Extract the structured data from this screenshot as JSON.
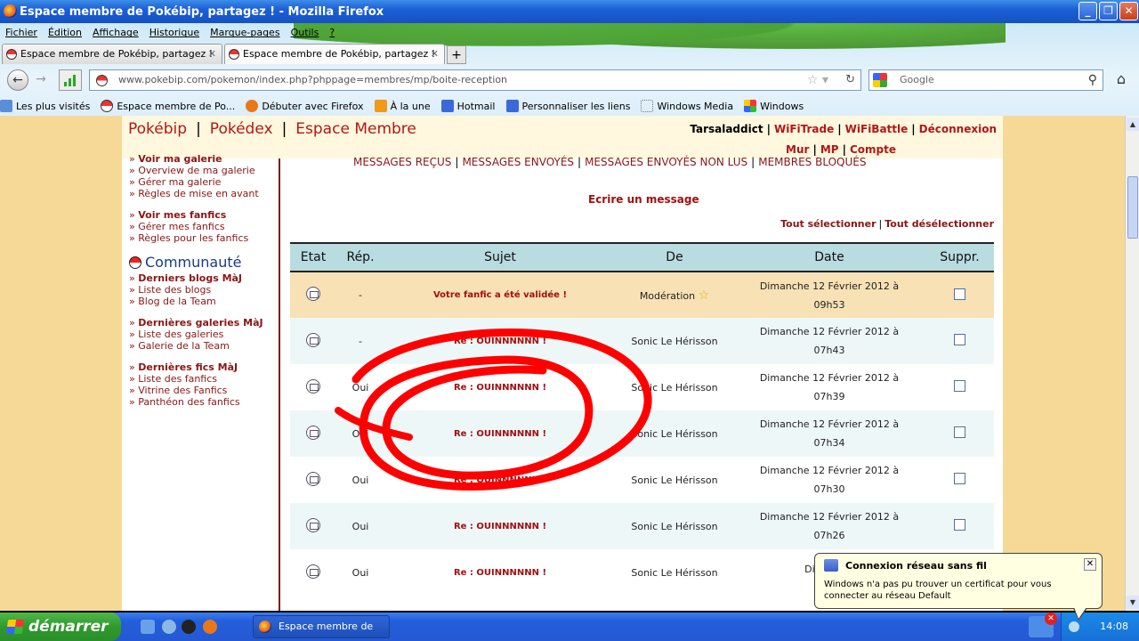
{
  "window": {
    "title": "Espace membre de Pokébip, partagez ! - Mozilla Firefox"
  },
  "menu": [
    "Fichier",
    "Édition",
    "Affichage",
    "Historique",
    "Marque-pages",
    "Outils",
    "?"
  ],
  "tabs": [
    {
      "label": "Espace membre de Pokébip, partagez !"
    },
    {
      "label": "Espace membre de Pokébip, partagez !"
    }
  ],
  "url": "www.pokebip.com/pokemon/index.php?phppage=membres/mp/boite-reception",
  "search_placeholder": "Google",
  "bookmarks": [
    "Les plus visités",
    "Espace membre de Po...",
    "Débuter avec Firefox",
    "À la une",
    "Hotmail",
    "Personnaliser les liens",
    "Windows Media",
    "Windows"
  ],
  "site": {
    "nav": [
      "Pokébip",
      "Pokédex",
      "Espace Membre"
    ],
    "user": "Tarsaladdict",
    "user_links": [
      "WiFiTrade",
      "WiFiBattle",
      "Déconnexion"
    ],
    "user_links2": [
      "Mur",
      "MP",
      "Compte"
    ]
  },
  "sidebar": {
    "group1": [
      "Voir ma galerie",
      "Overview de ma galerie",
      "Gérer ma galerie",
      "Règles de mise en avant"
    ],
    "group2": [
      "Voir mes fanfics",
      "Gérer mes fanfics",
      "Règles pour les fanfics"
    ],
    "community_heading": "Communauté",
    "group3": [
      "Derniers blogs MàJ",
      "Liste des blogs",
      "Blog de la Team"
    ],
    "group4": [
      "Dernières galeries MàJ",
      "Liste des galeries",
      "Galerie de la Team"
    ],
    "group5": [
      "Dernières fics MàJ",
      "Liste des fanfics",
      "Vitrine des Fanfics",
      "Panthéon des fanfics"
    ]
  },
  "mail_tabs": [
    "MESSAGES REÇUS",
    "MESSAGES ENVOYÉS",
    "MESSAGES ENVOYÉS NON LUS",
    "MEMBRES BLOQUÉS"
  ],
  "compose_label": "Ecrire un message",
  "select_all": "Tout sélectionner",
  "deselect_all": "Tout désélectionner",
  "table": {
    "headers": [
      "Etat",
      "Rép.",
      "Sujet",
      "De",
      "Date",
      "Suppr."
    ],
    "rows": [
      {
        "rep": "-",
        "subject": "Votre fanfic a été validée !",
        "from": "Modération",
        "date": "Dimanche 12 Février 2012 à",
        "time": "09h53"
      },
      {
        "rep": "-",
        "subject": "Re : OUINNNNNN !",
        "from": "Sonic Le Hérisson",
        "date": "Dimanche 12 Février 2012 à",
        "time": "07h43"
      },
      {
        "rep": "Oui",
        "subject": "Re : OUINNNNNN !",
        "from": "Sonic Le Hérisson",
        "date": "Dimanche 12 Février 2012 à",
        "time": "07h39"
      },
      {
        "rep": "Oui",
        "subject": "Re : OUINNNNNN !",
        "from": "Sonic Le Hérisson",
        "date": "Dimanche 12 Février 2012 à",
        "time": "07h34"
      },
      {
        "rep": "Oui",
        "subject": "Re : OUINNNNNN !",
        "from": "Sonic Le Hérisson",
        "date": "Dimanche 12 Février 2012 à",
        "time": "07h30"
      },
      {
        "rep": "Oui",
        "subject": "Re : OUINNNNNN !",
        "from": "Sonic Le Hérisson",
        "date": "Dimanche 12 Février 2012 à",
        "time": "07h26"
      },
      {
        "rep": "Oui",
        "subject": "Re : OUINNNNNN !",
        "from": "Sonic Le Hérisson",
        "date": "Dimanche",
        "time": ""
      }
    ]
  },
  "taskbar": {
    "start_label": "démarrer",
    "task_label": "Espace membre de P...",
    "clock": "14:08"
  },
  "balloon": {
    "title": "Connexion réseau sans fil",
    "message": "Windows n'a pas pu trouver un certificat pour vous connecter au réseau Default"
  },
  "colors": {
    "accent": "#b01818",
    "header_bg": "#b8dce0",
    "page_bg": "#f7d997",
    "scribble": "#ff0000"
  }
}
